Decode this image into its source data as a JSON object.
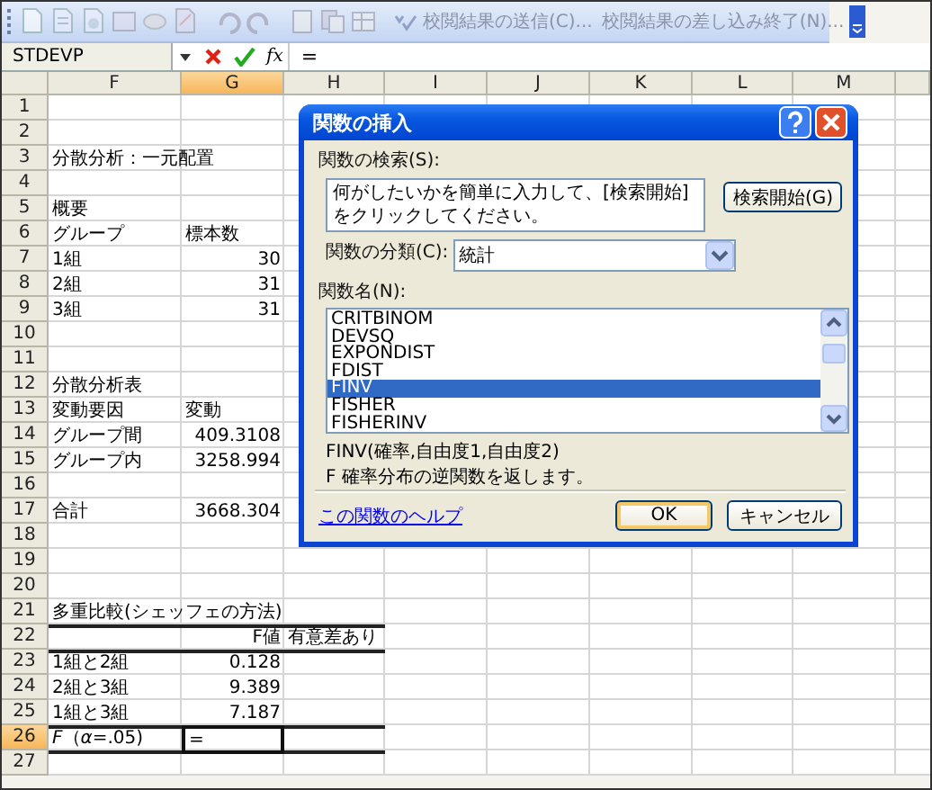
{
  "toolbar": {
    "buttons": [
      {
        "label": "校閲結果の送信(C)..."
      },
      {
        "label": "校閲結果の差し込み終了(N)..."
      }
    ]
  },
  "formula_bar": {
    "name_box": "STDEVP",
    "function_label": "fx",
    "formula": "="
  },
  "sheet": {
    "columns": [
      {
        "label": "F",
        "selected": false
      },
      {
        "label": "G",
        "selected": true
      },
      {
        "label": "H",
        "selected": false
      },
      {
        "label": "I",
        "selected": false
      },
      {
        "label": "J",
        "selected": false
      },
      {
        "label": "K",
        "selected": false
      },
      {
        "label": "L",
        "selected": false
      },
      {
        "label": "M",
        "selected": false
      }
    ],
    "rows": [
      {
        "label": "1",
        "selected": false,
        "rule_below": false
      },
      {
        "label": "2",
        "selected": false,
        "rule_below": false
      },
      {
        "label": "3",
        "selected": false,
        "rule_below": false,
        "cells": [
          {
            "kind": "label",
            "text": "分散分析：一元配置"
          }
        ]
      },
      {
        "label": "4",
        "selected": false,
        "rule_below": false
      },
      {
        "label": "5",
        "selected": false,
        "rule_below": false,
        "cells": [
          {
            "kind": "label",
            "text": "概要"
          }
        ]
      },
      {
        "label": "6",
        "selected": false,
        "rule_below": false,
        "cells": [
          {
            "kind": "label",
            "text": "グループ"
          },
          {
            "kind": "entry",
            "text": "標本数"
          }
        ]
      },
      {
        "label": "7",
        "selected": false,
        "rule_below": false,
        "cells": [
          {
            "kind": "label",
            "text": "1組"
          },
          {
            "kind": "value",
            "text": "30"
          }
        ]
      },
      {
        "label": "8",
        "selected": false,
        "rule_below": false,
        "cells": [
          {
            "kind": "label",
            "text": "2組"
          },
          {
            "kind": "value",
            "text": "31"
          }
        ]
      },
      {
        "label": "9",
        "selected": false,
        "rule_below": false,
        "cells": [
          {
            "kind": "label",
            "text": "3組"
          },
          {
            "kind": "value",
            "text": "31"
          }
        ]
      },
      {
        "label": "10",
        "selected": false,
        "rule_below": false
      },
      {
        "label": "11",
        "selected": false,
        "rule_below": false
      },
      {
        "label": "12",
        "selected": false,
        "rule_below": false,
        "cells": [
          {
            "kind": "label",
            "text": "分散分析表"
          }
        ]
      },
      {
        "label": "13",
        "selected": false,
        "rule_below": false,
        "cells": [
          {
            "kind": "label",
            "text": "変動要因"
          },
          {
            "kind": "entry",
            "text": "変動"
          }
        ]
      },
      {
        "label": "14",
        "selected": false,
        "rule_below": false,
        "cells": [
          {
            "kind": "label",
            "text": "グループ間"
          },
          {
            "kind": "value",
            "text": "409.3108"
          }
        ]
      },
      {
        "label": "15",
        "selected": false,
        "rule_below": false,
        "cells": [
          {
            "kind": "label",
            "text": "グループ内"
          },
          {
            "kind": "value",
            "text": "3258.994"
          }
        ]
      },
      {
        "label": "16",
        "selected": false,
        "rule_below": false
      },
      {
        "label": "17",
        "selected": false,
        "rule_below": false,
        "cells": [
          {
            "kind": "label",
            "text": "合計"
          },
          {
            "kind": "value",
            "text": "3668.304"
          }
        ]
      },
      {
        "label": "18",
        "selected": false,
        "rule_below": false
      },
      {
        "label": "19",
        "selected": false,
        "rule_below": false
      },
      {
        "label": "20",
        "selected": false,
        "rule_below": false
      },
      {
        "label": "21",
        "selected": false,
        "rule_below": true,
        "cells": [
          {
            "kind": "label",
            "text": "多重比較(シェッフェの方法)"
          }
        ]
      },
      {
        "label": "22",
        "selected": false,
        "rule_below": true,
        "cells": [
          {
            "kind": "value",
            "text": "F値"
          },
          {
            "kind": "note",
            "text": "有意差あり"
          }
        ]
      },
      {
        "label": "23",
        "selected": false,
        "rule_below": false,
        "cells": [
          {
            "kind": "label",
            "text": "1組と2組"
          },
          {
            "kind": "value",
            "text": "0.128"
          }
        ]
      },
      {
        "label": "24",
        "selected": false,
        "rule_below": false,
        "cells": [
          {
            "kind": "label",
            "text": "2組と3組"
          },
          {
            "kind": "value",
            "text": "9.389"
          }
        ]
      },
      {
        "label": "25",
        "selected": false,
        "rule_below": true,
        "cells": [
          {
            "kind": "label",
            "text": "1組と3組"
          },
          {
            "kind": "value",
            "text": "7.187"
          }
        ]
      },
      {
        "label": "26",
        "selected": true,
        "rule_below": true,
        "cells": [
          {
            "kind": "label",
            "text": "*F*（*α*=.05)"
          },
          {
            "kind": "entry",
            "text": "="
          }
        ]
      },
      {
        "label": "27",
        "selected": false,
        "rule_below": false
      }
    ]
  },
  "dialog": {
    "title": "関数の挿入",
    "search_label": "関数の検索(S):",
    "search_value": "何がしたいかを簡単に入力して、[検索開始] をクリックしてください。",
    "search_button": "検索開始(G)",
    "category_label": "関数の分類(C):",
    "category_value": "統計",
    "list_label": "関数名(N):",
    "functions": [
      {
        "name": "CRITBINOM",
        "selected": false
      },
      {
        "name": "DEVSQ",
        "selected": false
      },
      {
        "name": "EXPONDIST",
        "selected": false
      },
      {
        "name": "FDIST",
        "selected": false
      },
      {
        "name": "FINV",
        "selected": true
      },
      {
        "name": "FISHER",
        "selected": false
      },
      {
        "name": "FISHERINV",
        "selected": false
      }
    ],
    "signature": "FINV(確率,自由度1,自由度2)",
    "description": "F 確率分布の逆関数を返します。",
    "help_link": "この関数のヘルプ",
    "buttons": [
      {
        "label": "OK",
        "default": true
      },
      {
        "label": "キャンセル",
        "default": false
      }
    ]
  }
}
